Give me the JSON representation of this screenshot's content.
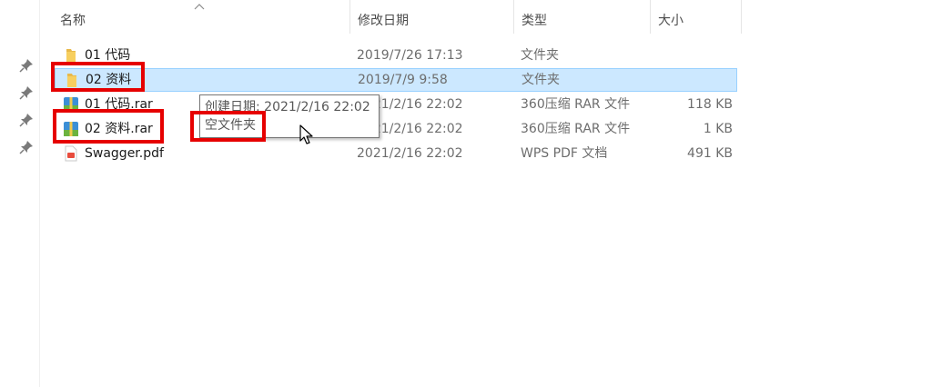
{
  "columns": {
    "name": "名称",
    "date": "修改日期",
    "type": "类型",
    "size": "大小"
  },
  "files": [
    {
      "name": "01 代码",
      "date": "2019/7/26 17:13",
      "type": "文件夹",
      "size": "",
      "icon": "folder-icon",
      "selected": false
    },
    {
      "name": "02 资料",
      "date": "2019/7/9 9:58",
      "type": "文件夹",
      "size": "",
      "icon": "folder-icon",
      "selected": true
    },
    {
      "name": "01 代码.rar",
      "date": "2021/2/16 22:02",
      "type": "360压缩 RAR 文件",
      "size": "118 KB",
      "icon": "rar-archive-icon",
      "selected": false
    },
    {
      "name": "02 资料.rar",
      "date": "2021/2/16 22:02",
      "type": "360压缩 RAR 文件",
      "size": "1 KB",
      "icon": "rar-archive-icon",
      "selected": false
    },
    {
      "name": "Swagger.pdf",
      "date": "2021/2/16 22:02",
      "type": "WPS PDF 文档",
      "size": "491 KB",
      "icon": "pdf-icon",
      "selected": false
    }
  ],
  "tooltip": {
    "created": "创建日期: 2021/2/16 22:02",
    "status": "空文件夹"
  },
  "colors": {
    "selection": "#cce8ff",
    "highlight": "#e60000"
  }
}
